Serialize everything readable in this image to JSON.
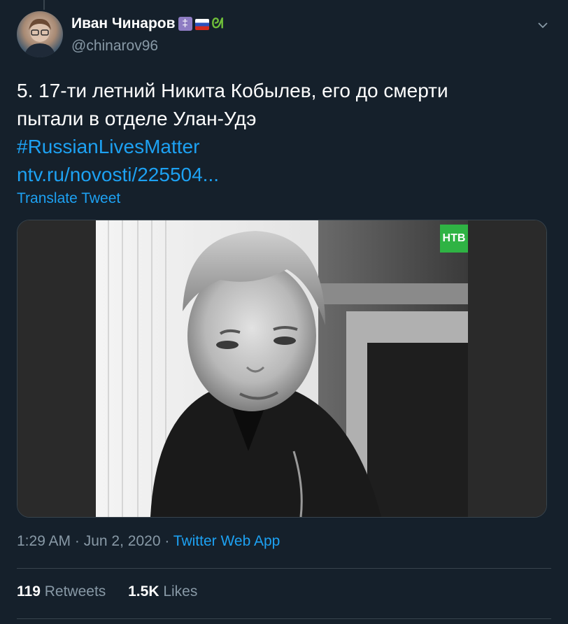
{
  "author": {
    "display_name": "Иван Чинаров",
    "handle": "@chinarov96",
    "emoji_badges": [
      "orthodox-cross",
      "russian-flag",
      "snake"
    ]
  },
  "tweet": {
    "text_line_1": "5. 17-ти летний Никита Кобылев, его до смерти",
    "text_line_2": "пытали в отделе Улан-Удэ",
    "hashtag": "#RussianLivesMatter",
    "link": "ntv.ru/novosti/225504..."
  },
  "translate_label": "Translate Tweet",
  "media": {
    "logo_text": "НТВ"
  },
  "meta": {
    "time": "1:29 AM",
    "sep1": " · ",
    "date": "Jun 2, 2020",
    "sep2": " · ",
    "source": "Twitter Web App"
  },
  "stats": {
    "retweets_count": "119",
    "retweets_label": "Retweets",
    "likes_count": "1.5K",
    "likes_label": "Likes"
  },
  "colors": {
    "background": "#15202b",
    "accent": "#1da1f2",
    "secondary_text": "#8899a6",
    "border": "#38444d"
  }
}
